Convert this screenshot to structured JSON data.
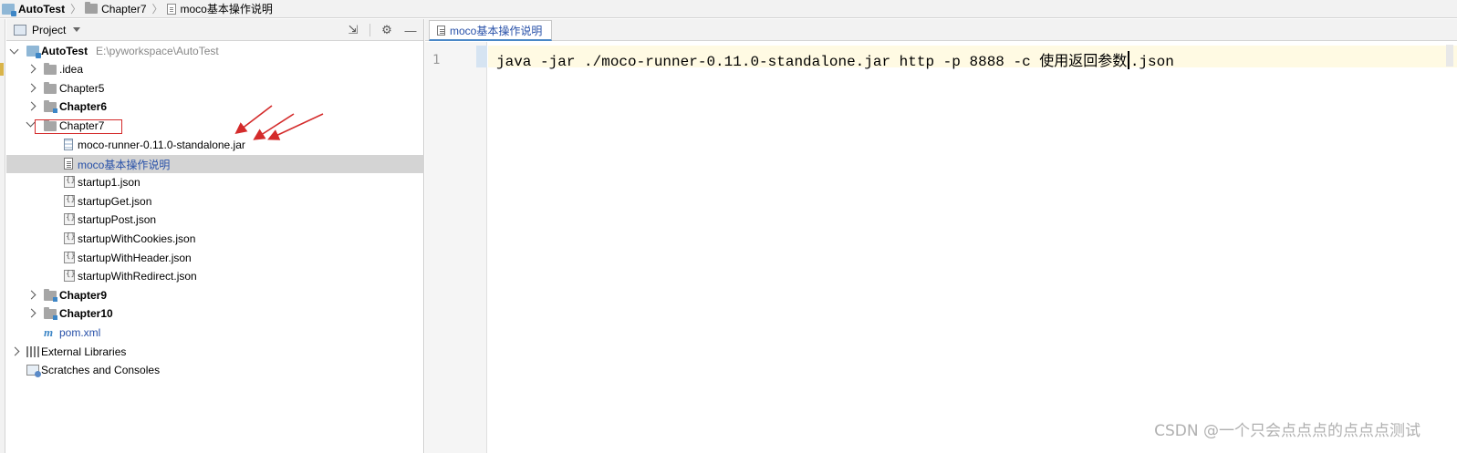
{
  "breadcrumb": {
    "items": [
      "AutoTest",
      "Chapter7",
      "moco基本操作说明"
    ]
  },
  "project_panel": {
    "title": "Project",
    "header_icons": [
      "collapse-icon",
      "gear-icon",
      "minimize-icon"
    ]
  },
  "tree": {
    "root": {
      "label": "AutoTest",
      "path": "E:\\pyworkspace\\AutoTest"
    },
    "items": [
      {
        "label": ".idea"
      },
      {
        "label": "Chapter5"
      },
      {
        "label": "Chapter6"
      },
      {
        "label": "Chapter7"
      },
      {
        "label": "moco-runner-0.11.0-standalone.jar"
      },
      {
        "label": "moco基本操作说明"
      },
      {
        "label": "startup1.json"
      },
      {
        "label": "startupGet.json"
      },
      {
        "label": "startupPost.json"
      },
      {
        "label": "startupWithCookies.json"
      },
      {
        "label": "startupWithHeader.json"
      },
      {
        "label": "startupWithRedirect.json"
      },
      {
        "label": "Chapter9"
      },
      {
        "label": "Chapter10"
      },
      {
        "label": "pom.xml"
      },
      {
        "label": "External Libraries"
      },
      {
        "label": "Scratches and Consoles"
      }
    ]
  },
  "editor": {
    "tab_label": "moco基本操作说明",
    "line_number": "1",
    "code_before_caret": "java -jar ./moco-runner-0.11.0-standalone.jar http -p 8888 -c 使用返回参数",
    "code_after_caret": ".json"
  },
  "watermark": "CSDN @一个只会点点点的点点点测试",
  "colors": {
    "annotation_red": "#d42b2b",
    "selection": "#d4d4d4",
    "link_blue": "#2750a8",
    "current_line": "#fffae3"
  }
}
